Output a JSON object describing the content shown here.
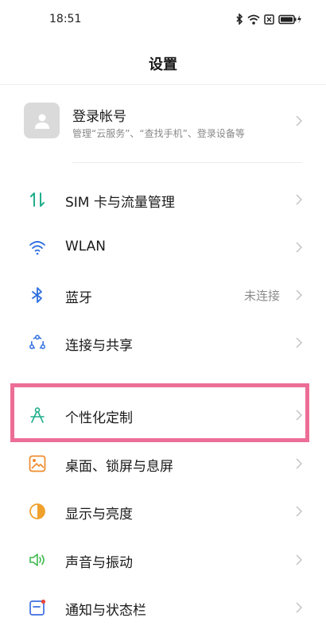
{
  "status_bar": {
    "time": "18:51",
    "icons": [
      "bluetooth-icon",
      "wifi-icon",
      "sim-icon",
      "battery-charging-icon"
    ]
  },
  "header": {
    "title": "设置"
  },
  "account": {
    "title": "登录帐号",
    "subtitle": "管理“云服务”、“查找手机”、登录设备等",
    "icon": "user-avatar-icon"
  },
  "items_group1": [
    {
      "label": "SIM 卡与流量管理",
      "icon": "sim-data-icon",
      "color": "#1fae8a"
    },
    {
      "label": "WLAN",
      "icon": "wifi-icon",
      "color": "#2f6fe0"
    },
    {
      "label": "蓝牙",
      "value": "未连接",
      "icon": "bluetooth-icon",
      "color": "#2f6fe0"
    },
    {
      "label": "连接与共享",
      "icon": "connection-share-icon",
      "color": "#2f6fe0"
    }
  ],
  "items_group2": [
    {
      "label": "个性化定制",
      "icon": "personalization-icon",
      "color": "#1fae8a"
    },
    {
      "label": "桌面、锁屏与息屏",
      "icon": "wallpaper-icon",
      "color": "#f08a2c"
    },
    {
      "label": "显示与亮度",
      "icon": "brightness-icon",
      "color": "#f0a12c"
    },
    {
      "label": "声音与振动",
      "icon": "sound-icon",
      "color": "#3dba4e"
    },
    {
      "label": "通知与状态栏",
      "icon": "notification-icon",
      "color": "#3d6fe0"
    }
  ],
  "highlight_color": "#ec6e96"
}
